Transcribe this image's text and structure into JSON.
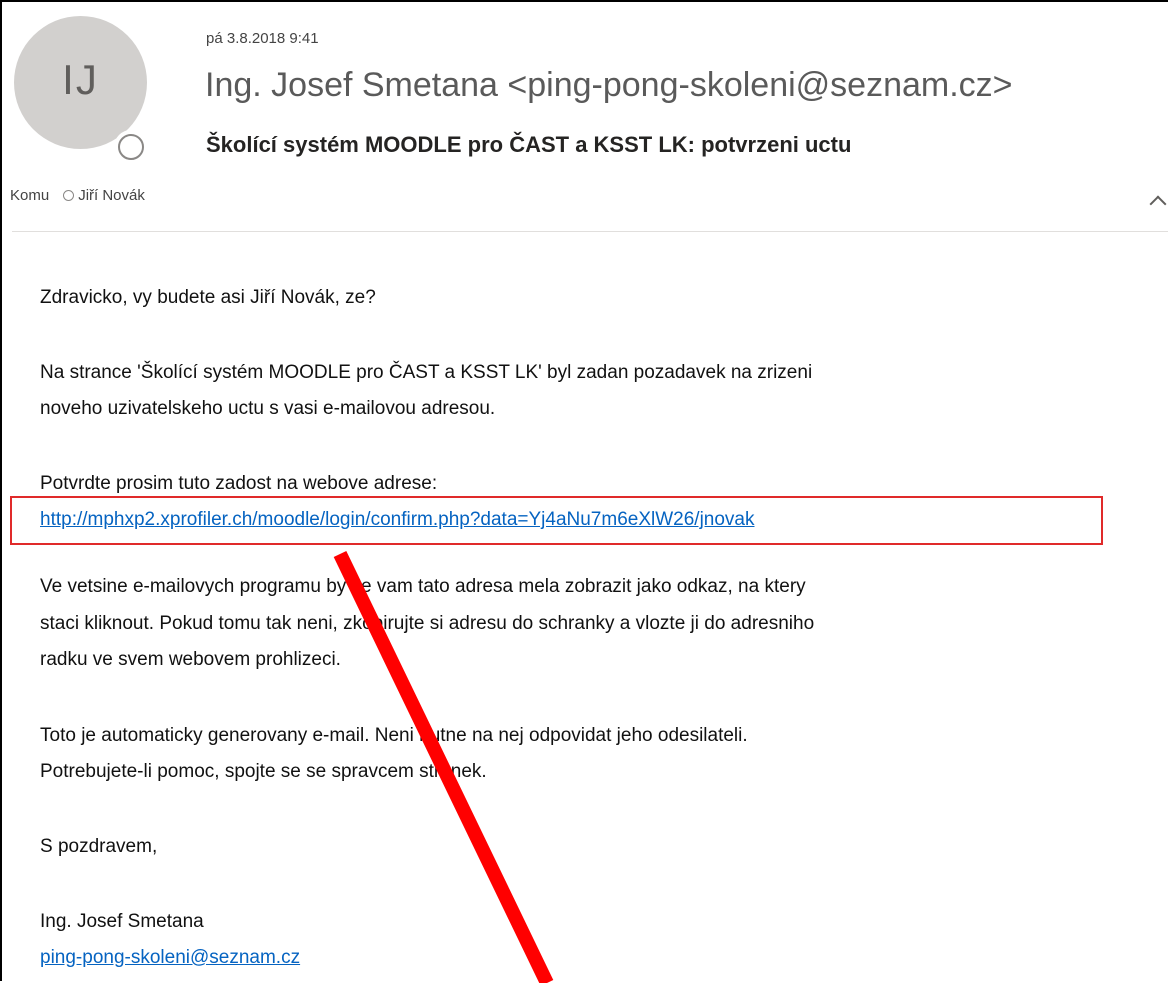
{
  "header": {
    "avatar_initials": "IJ",
    "date": "pá 3.8.2018 9:41",
    "sender": "Ing. Josef Smetana <ping-pong-skoleni@seznam.cz>",
    "subject": "Školící systém MOODLE pro ČAST a KSST LK: potvrzeni uctu",
    "to_label": "Komu",
    "recipient": "Jiří Novák"
  },
  "body": {
    "greeting": "Zdravicko, vy budete asi Jiří Novák, ze?",
    "para1_line1": "Na strance 'Školící systém MOODLE pro ČAST a KSST LK' byl zadan pozadavek na zrizeni",
    "para1_line2": "noveho uzivatelskeho uctu s vasi e-mailovou adresou.",
    "para2_line1": "Potvrdte prosim tuto zadost na webove adrese:",
    "confirm_link": "http://mphxp2.xprofiler.ch/moodle/login/confirm.php?data=Yj4aNu7m6eXlW26/jnovak",
    "para3_line1": "Ve vetsine e-mailovych programu by se vam tato adresa mela zobrazit jako odkaz, na ktery",
    "para3_line2": "staci kliknout. Pokud tomu tak neni, zkopirujte si adresu do schranky a vlozte ji do adresniho",
    "para3_line3": "radku ve svem webovem prohlizeci.",
    "para4_line1": "Toto je automaticky generovany e-mail. Neni nutne na nej odpovidat jeho odesilateli.",
    "para4_line2": "Potrebujete-li pomoc, spojte se se spravcem stranek.",
    "closing": "S pozdravem,",
    "signature_name": "Ing. Josef Smetana",
    "signature_email": "ping-pong-skoleni@seznam.cz"
  },
  "colors": {
    "link": "#0563c1",
    "annotation": "#e02a2a",
    "avatar_bg": "#d2d0ce"
  }
}
